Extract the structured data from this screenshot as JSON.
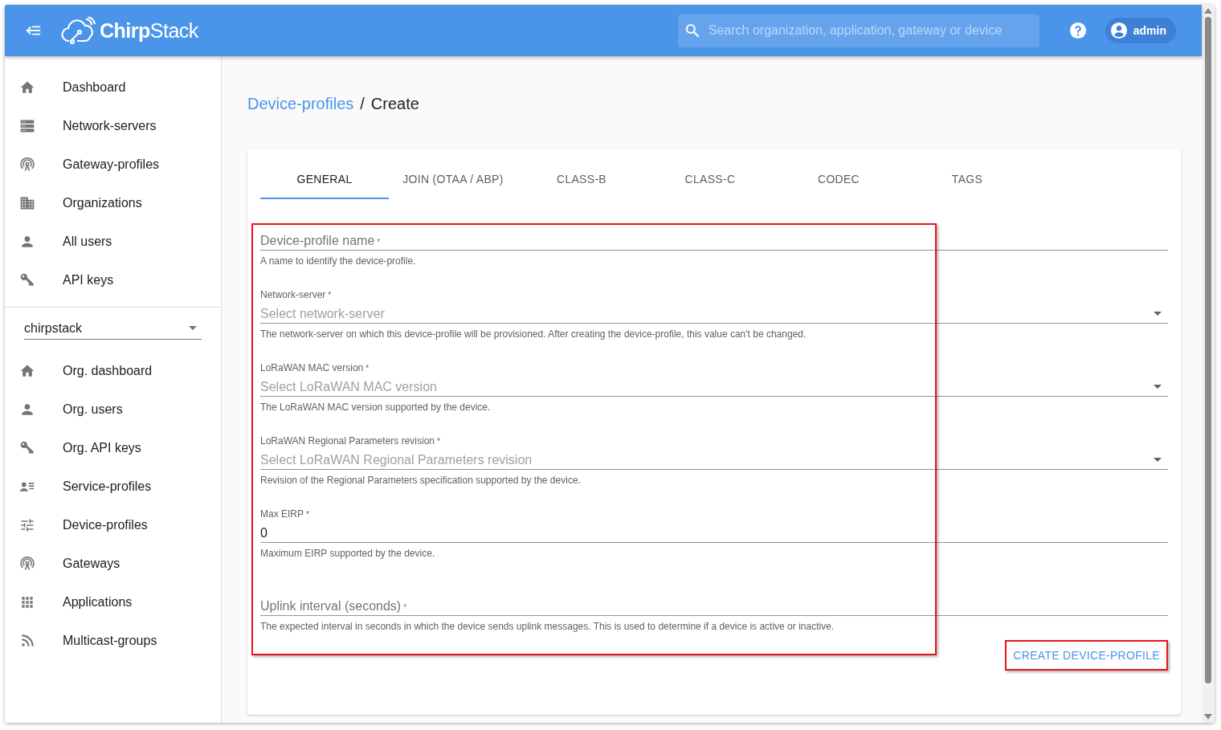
{
  "header": {
    "logo": {
      "bold": "Chirp",
      "light": "Stack"
    },
    "search": {
      "placeholder": "Search organization, application, gateway or device"
    },
    "user": "admin"
  },
  "sidebar": {
    "items": [
      {
        "label": "Dashboard"
      },
      {
        "label": "Network-servers"
      },
      {
        "label": "Gateway-profiles"
      },
      {
        "label": "Organizations"
      },
      {
        "label": "All users"
      },
      {
        "label": "API keys"
      }
    ],
    "org_select": {
      "value": "chirpstack"
    },
    "org_items": [
      {
        "label": "Org. dashboard"
      },
      {
        "label": "Org. users"
      },
      {
        "label": "Org. API keys"
      },
      {
        "label": "Service-profiles"
      },
      {
        "label": "Device-profiles"
      },
      {
        "label": "Gateways"
      },
      {
        "label": "Applications"
      },
      {
        "label": "Multicast-groups"
      }
    ]
  },
  "breadcrumb": {
    "parent": "Device-profiles",
    "separator": "/",
    "current": "Create"
  },
  "tabs": [
    {
      "label": "GENERAL",
      "selected": true
    },
    {
      "label": "JOIN (OTAA / ABP)",
      "selected": false
    },
    {
      "label": "CLASS-B",
      "selected": false
    },
    {
      "label": "CLASS-C",
      "selected": false
    },
    {
      "label": "CODEC",
      "selected": false
    },
    {
      "label": "TAGS",
      "selected": false
    }
  ],
  "form": {
    "highlighted": true,
    "fields": [
      {
        "kind": "text",
        "label": "Device-profile name",
        "required_mark": "*",
        "helper": "A name to identify the device-profile."
      },
      {
        "kind": "select",
        "label": "Network-server",
        "required_mark": "*",
        "placeholder": "Select network-server",
        "helper": "The network-server on which this device-profile will be provisioned. After creating the device-profile, this value can't be changed."
      },
      {
        "kind": "select",
        "label": "LoRaWAN MAC version",
        "required_mark": "*",
        "placeholder": "Select LoRaWAN MAC version",
        "helper": "The LoRaWAN MAC version supported by the device."
      },
      {
        "kind": "select",
        "label": "LoRaWAN Regional Parameters revision",
        "required_mark": "*",
        "placeholder": "Select LoRaWAN Regional Parameters revision",
        "helper": "Revision of the Regional Parameters specification supported by the device."
      },
      {
        "kind": "number",
        "label": "Max EIRP",
        "required_mark": "*",
        "value": "0",
        "helper": "Maximum EIRP supported by the device."
      },
      {
        "kind": "text",
        "label": "Uplink interval (seconds)",
        "required_mark": "*",
        "helper": "The expected interval in seconds in which the device sends uplink messages. This is used to determine if a device is active or inactive."
      }
    ]
  },
  "submit": {
    "label": "CREATE DEVICE-PROFILE",
    "highlighted": true
  }
}
